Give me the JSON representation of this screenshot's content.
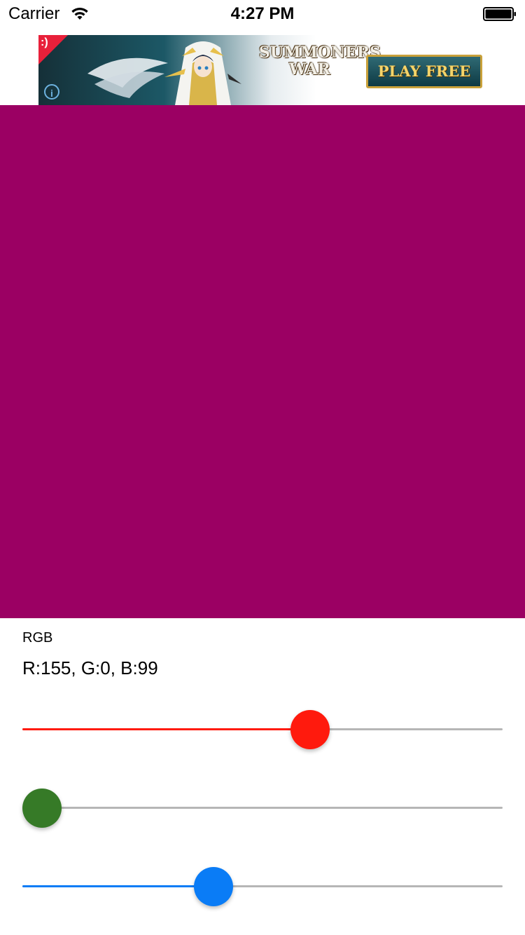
{
  "status_bar": {
    "carrier": "Carrier",
    "time": "4:27 PM",
    "wifi_icon": "wifi-icon",
    "battery_icon": "battery-full-icon"
  },
  "ad": {
    "corner_badge": ":)",
    "info_icon": "i",
    "logo_line1": "SUMMONERS",
    "logo_line2": "WAR",
    "play_button": "PLAY FREE"
  },
  "color": {
    "r": 155,
    "g": 0,
    "b": 99,
    "hex": "#9b0063"
  },
  "labels": {
    "mode": "RGB",
    "value": "R:155, G:0, B:99"
  },
  "sliders": [
    {
      "name": "red",
      "value": 155,
      "max": 255,
      "color": "#ff1a0d",
      "thumb_color": "#ff1a0d"
    },
    {
      "name": "green",
      "value": 0,
      "max": 255,
      "color": "#2f7a25",
      "thumb_color": "#367a27"
    },
    {
      "name": "blue",
      "value": 99,
      "max": 255,
      "color": "#0a7cf6",
      "thumb_color": "#0a7cf6"
    }
  ]
}
